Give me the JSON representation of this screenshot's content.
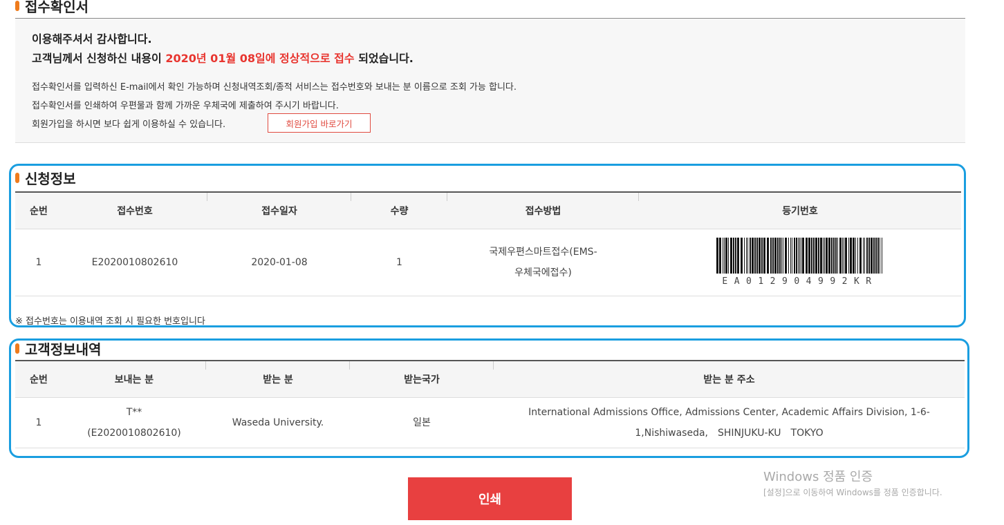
{
  "receipt": {
    "title": "접수확인서",
    "thanks_line1": "이용해주셔서 감사합니다.",
    "thanks_prefix": "고객님께서 신청하신 내용이 ",
    "thanks_highlight": "2020년 01월 08일에 정상적으로 접수",
    "thanks_suffix": " 되었습니다.",
    "note1": "접수확인서를 입력하신 E-mail에서 확인 가능하며 신청내역조회/종적 서비스는 접수번호와 보내는 분 이름으로 조회 가능 합니다.",
    "note2": "접수확인서를 인쇄하여 우편물과 함께 가까운 우체국에 제출하여 주시기 바랍니다.",
    "note3": "회원가입을 하시면 보다 쉽게 이용하실 수 있습니다.",
    "join_button": "회원가입 바로가기"
  },
  "application": {
    "title": "신청정보",
    "headers": [
      "순번",
      "접수번호",
      "접수일자",
      "수량",
      "접수방법",
      "등기번호"
    ],
    "row": {
      "no": "1",
      "receipt_no": "E2020010802610",
      "date": "2020-01-08",
      "qty": "1",
      "method_line1": "국제우편스마트접수(EMS-",
      "method_line2": "우체국에접수)",
      "registered_no": "EA012904992KR"
    },
    "footnote": "※ 접수번호는 이용내역 조회 시 필요한 번호입니다"
  },
  "customer": {
    "title": "고객정보내역",
    "headers": [
      "순번",
      "보내는 분",
      "받는 분",
      "받는국가",
      "받는 분 주소"
    ],
    "row": {
      "no": "1",
      "sender_line1": "T**",
      "sender_line2": "(E2020010802610)",
      "recipient": "Waseda University.",
      "country": "일본",
      "address_line1": "International Admissions Office, Admissions Center, Academic Affairs Division, 1-6-",
      "address_line2": "1,Nishiwaseda,　SHINJUKU-KU　TOKYO"
    }
  },
  "print_button": "인쇄",
  "watermark": {
    "line1": "Windows 정품 인증",
    "line2": "[설정]으로 이동하여 Windows를 정품 인증합니다."
  },
  "colors": {
    "accent_red": "#e8352f",
    "frame_blue": "#1a9ee0",
    "title_bar": "#ef7b1c"
  }
}
